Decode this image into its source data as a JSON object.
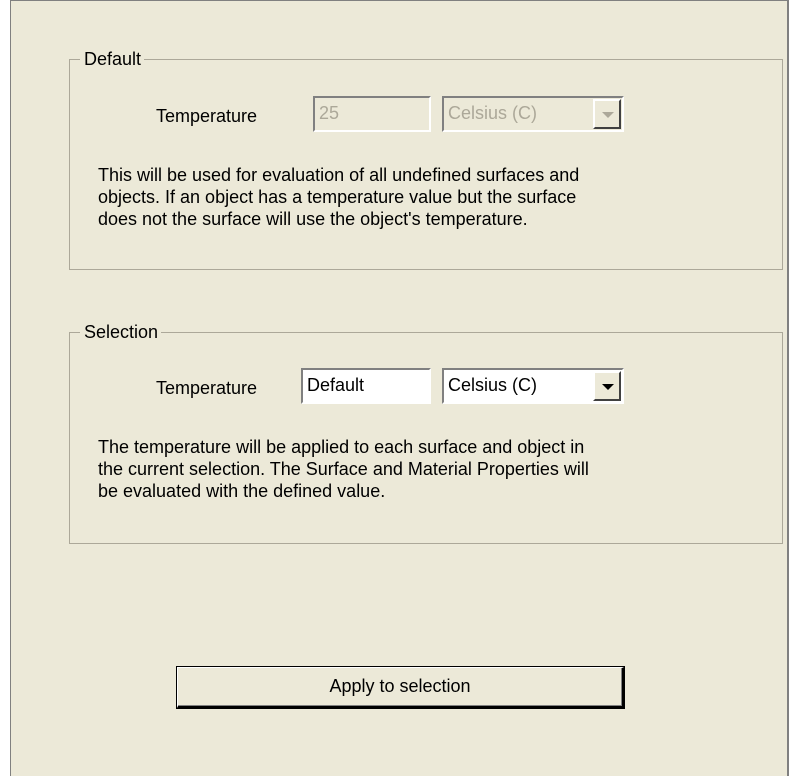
{
  "default_group": {
    "title": "Default",
    "temperature_label": "Temperature",
    "temperature_value": "25",
    "unit_selected": "Celsius  (C)",
    "enabled": false,
    "description_lines": [
      "This will be used for evaluation of all undefined surfaces and",
      "objects. If an object has a temperature value but the surface",
      "does not the surface will use the object's temperature."
    ]
  },
  "selection_group": {
    "title": "Selection",
    "temperature_label": "Temperature",
    "temperature_value": "Default",
    "unit_selected": "Celsius  (C)",
    "enabled": true,
    "description_lines": [
      "The temperature will be applied to each surface and object in",
      "the current selection. The Surface and Material Properties will",
      "be evaluated with the defined value."
    ]
  },
  "apply_button": {
    "label": "Apply to selection"
  },
  "icons": {
    "dropdown": "chevron-down-icon"
  }
}
